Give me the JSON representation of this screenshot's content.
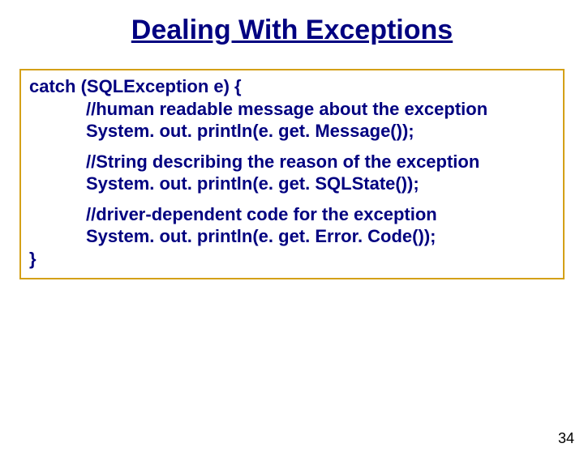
{
  "title": "Dealing With Exceptions",
  "code": {
    "l1": "catch (SQLException e) {",
    "l2": "//human readable message about the exception",
    "l3": "System. out. println(e. get. Message());",
    "l4": "//String describing the reason of the exception",
    "l5": "System. out. println(e. get. SQLState());",
    "l6": "//driver-dependent code for the exception",
    "l7": "System. out. println(e. get. Error. Code());",
    "l8": "}"
  },
  "page_number": "34"
}
